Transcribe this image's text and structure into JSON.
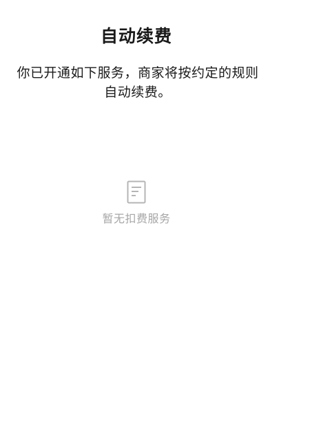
{
  "header": {
    "title": "自动续费"
  },
  "notice": {
    "text": "你已开通如下服务，商家将按约定的规则自动续费。"
  },
  "empty_state": {
    "icon": "document-icon",
    "text": "暂无扣费服务"
  }
}
